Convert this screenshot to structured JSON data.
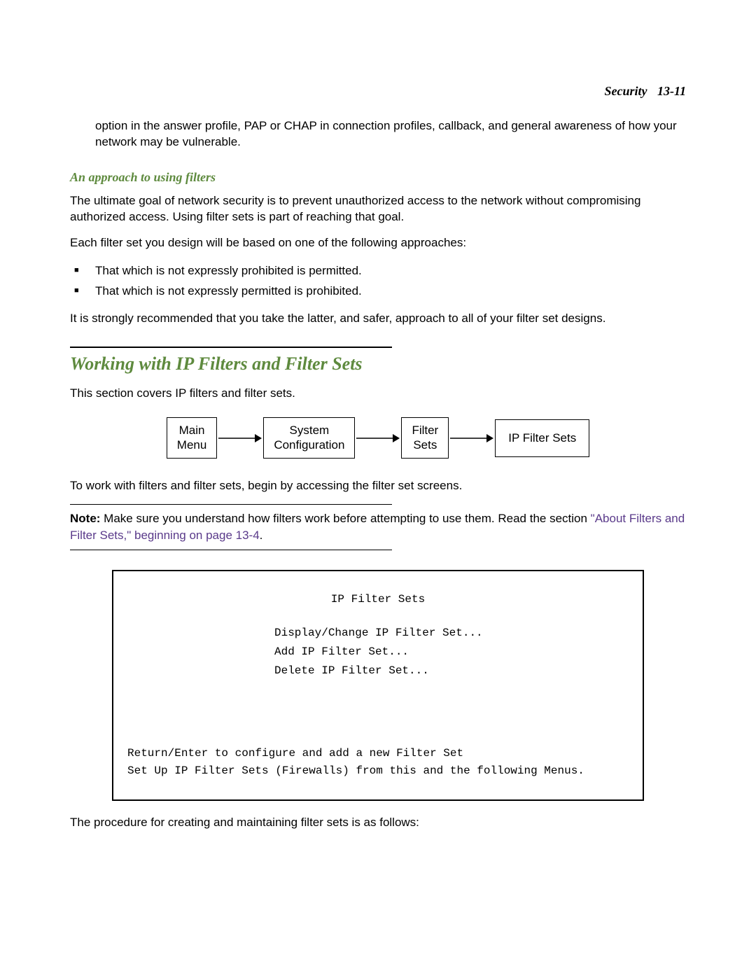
{
  "header": {
    "section": "Security",
    "page": "13-11"
  },
  "intro_paragraph": "option in the answer profile, PAP or CHAP in connection profiles, callback, and general awareness of how your network may be vulnerable.",
  "approach": {
    "heading": "An approach to using filters",
    "para1": "The ultimate goal of network security is to prevent unauthorized access to the network without compromising authorized access. Using filter sets is part of reaching that goal.",
    "para2": "Each filter set you design will be based on one of the following approaches:",
    "bullets": [
      "That which is not expressly prohibited is permitted.",
      "That which is not expressly permitted is prohibited."
    ],
    "para3": "It is strongly recommended that you take the latter, and safer, approach to all of your filter set designs."
  },
  "working": {
    "heading": "Working with IP Filters and Filter Sets",
    "intro": "This section covers IP filters and filter sets.",
    "nav": {
      "box1_l1": "Main",
      "box1_l2": "Menu",
      "box2_l1": "System",
      "box2_l2": "Configuration",
      "box3_l1": "Filter",
      "box3_l2": "Sets",
      "box4": "IP Filter Sets"
    },
    "para_after": "To work with filters and filter sets, begin by accessing the filter set screens.",
    "note_label": "Note:",
    "note_body": " Make sure you understand how filters work before attempting to use them. Read the section ",
    "note_link": "\"About Filters and Filter Sets,\" beginning on page 13-4",
    "note_tail": "."
  },
  "terminal": {
    "title": "IP Filter Sets",
    "menu": [
      "Display/Change IP Filter Set...",
      "Add IP Filter Set...",
      "Delete IP Filter Set..."
    ],
    "footer1": "Return/Enter to configure and add a new Filter Set",
    "footer2": "Set Up IP Filter Sets (Firewalls) from this and the following Menus."
  },
  "closing": "The procedure for creating and maintaining filter sets is as follows:"
}
